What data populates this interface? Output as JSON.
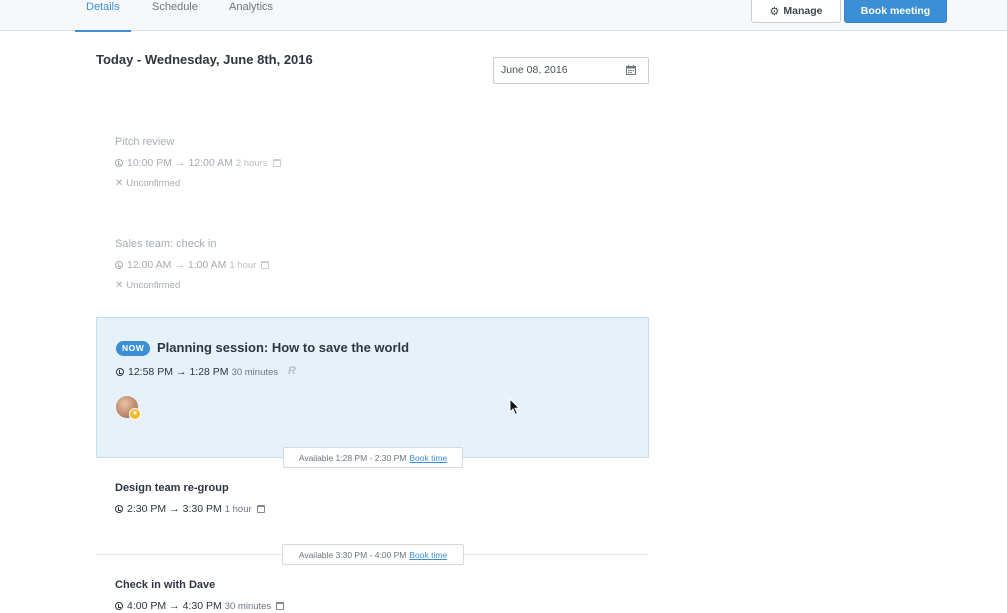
{
  "nav": {
    "tabs": [
      {
        "label": "Details",
        "active": true
      },
      {
        "label": "Schedule",
        "active": false
      },
      {
        "label": "Analytics",
        "active": false
      }
    ],
    "manage_label": "Manage",
    "book_label": "Book meeting"
  },
  "day_heading": "Today - Wednesday, June 8th, 2016",
  "date_picker": {
    "value": "June 08, 2016",
    "icon": "calendar-icon"
  },
  "events": [
    {
      "title": "Pitch review",
      "start": "10:00 PM",
      "end": "12:00 AM",
      "duration": "2 hours",
      "status": "Unconfirmed"
    },
    {
      "title": "Sales team: check in",
      "start": "12:00 AM",
      "end": "1:00 AM",
      "duration": "1 hour",
      "status": "Unconfirmed"
    }
  ],
  "current": {
    "badge": "NOW",
    "title": "Planning session: How to save the world",
    "start": "12:58 PM",
    "end": "1:28 PM",
    "duration": "30 minutes",
    "icon": "R"
  },
  "availability": [
    {
      "text": "Available 1:28 PM - 2:30 PM",
      "link": "Book time"
    },
    {
      "text": "Available 3:30 PM - 4:00 PM",
      "link": "Book time"
    }
  ],
  "upcoming": [
    {
      "title": "Design team re-group",
      "start": "2:30 PM",
      "end": "3:30 PM",
      "duration": "1 hour"
    },
    {
      "title": "Check in with Dave",
      "start": "4:00 PM",
      "end": "4:30 PM",
      "duration": "30 minutes"
    }
  ],
  "symbols": {
    "arrow": "→",
    "x": "✕",
    "gear": "⚙",
    "star": "★"
  },
  "colors": {
    "accent": "#3a8fd6",
    "now_bg": "#e6f1f9",
    "muted": "#a6adb4"
  }
}
